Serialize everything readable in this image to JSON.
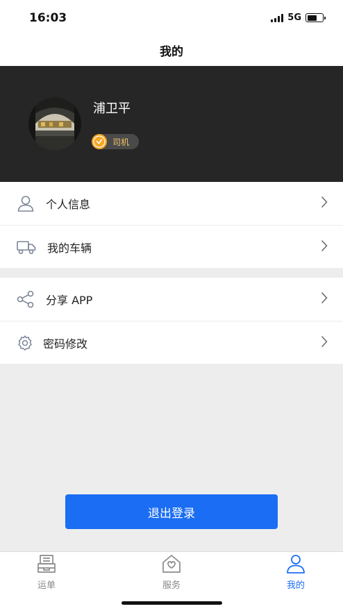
{
  "status_bar": {
    "time": "16:03",
    "network": "5G",
    "battery_level": 0.65
  },
  "nav": {
    "title": "我的"
  },
  "profile": {
    "name": "浦卫平",
    "role": "司机"
  },
  "menu_groups": [
    {
      "items": [
        {
          "label": "个人信息",
          "icon": "user-icon"
        },
        {
          "label": "我的车辆",
          "icon": "truck-icon"
        }
      ]
    },
    {
      "items": [
        {
          "label": "分享 APP",
          "icon": "share-icon"
        },
        {
          "label": "密码修改",
          "icon": "gear-icon"
        }
      ]
    }
  ],
  "logout": {
    "label": "退出登录"
  },
  "tabs": [
    {
      "label": "运单",
      "icon": "waybill-icon",
      "active": false
    },
    {
      "label": "服务",
      "icon": "service-icon",
      "active": false
    },
    {
      "label": "我的",
      "icon": "profile-icon",
      "active": true
    }
  ],
  "colors": {
    "accent": "#1b6ef3",
    "header_bg": "#262626",
    "badge": "#f5a623"
  }
}
